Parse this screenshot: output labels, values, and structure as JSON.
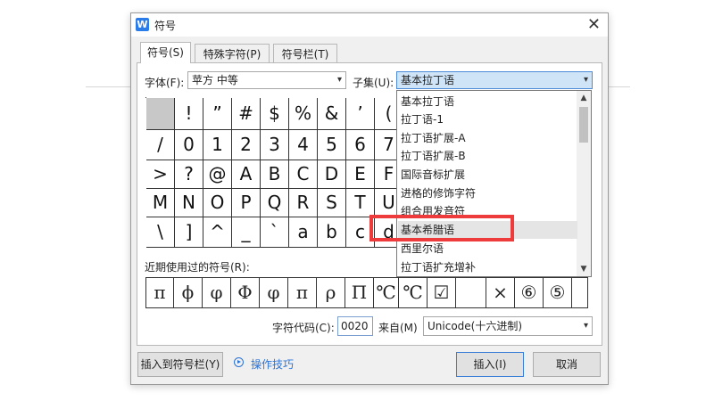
{
  "dialog": {
    "title": "符号",
    "app_icon": "W",
    "close": "✕"
  },
  "tabs": [
    {
      "label": "符号(S)"
    },
    {
      "label": "特殊字符(P)"
    },
    {
      "label": "符号栏(T)"
    }
  ],
  "font": {
    "label": "字体(F):",
    "value": "苹方 中等"
  },
  "subset": {
    "label": "子集(U):",
    "value": "基本拉丁语"
  },
  "grid": [
    [
      "",
      "!",
      "”",
      "#",
      "$",
      "%",
      "&",
      "’",
      "("
    ],
    [
      "/",
      "0",
      "1",
      "2",
      "3",
      "4",
      "5",
      "6",
      "7"
    ],
    [
      ">",
      "?",
      "@",
      "A",
      "B",
      "C",
      "D",
      "E",
      "F"
    ],
    [
      "M",
      "N",
      "O",
      "P",
      "Q",
      "R",
      "S",
      "T",
      "U"
    ],
    [
      "\\",
      "]",
      "^",
      "_",
      "`",
      "a",
      "b",
      "c",
      "d"
    ]
  ],
  "subset_options": [
    "基本拉丁语",
    "拉丁语-1",
    "拉丁语扩展-A",
    "拉丁语扩展-B",
    "国际音标扩展",
    "进格的修饰字符",
    "组合用发音符",
    "基本希腊语",
    "西里尔语",
    "拉丁语扩充增补"
  ],
  "recent": {
    "label": "近期使用过的符号(R):",
    "symbols": [
      "π",
      "ϕ",
      "φ",
      "Φ",
      "φ",
      "π",
      "ρ",
      "Π",
      "℃",
      "℃",
      "☑",
      "",
      "×",
      "⑥",
      "⑤",
      ""
    ]
  },
  "char_code": {
    "label": "字符代码(C):",
    "value": "0020"
  },
  "from": {
    "label": "来自(M)",
    "value": "Unicode(十六进制)"
  },
  "buttons": {
    "insert_to_bar": "插入到符号栏(Y)",
    "tips": "操作技巧",
    "insert": "插入(I)",
    "cancel": "取消"
  },
  "icons": {
    "arrow": "▾",
    "scroll_up": "▲",
    "scroll_down": "▼"
  }
}
